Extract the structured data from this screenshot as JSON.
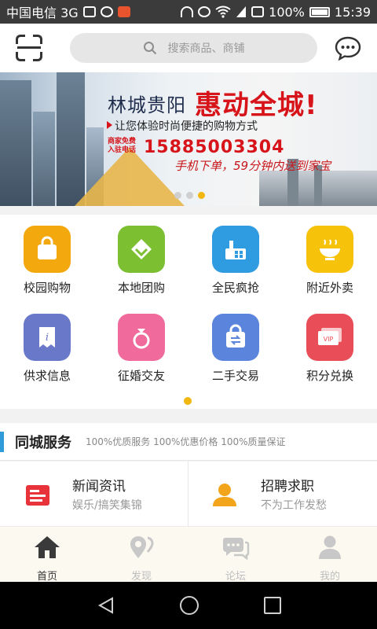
{
  "status_bar": {
    "carrier": "中国电信 3G",
    "battery": "100%",
    "time": "15:39"
  },
  "header": {
    "search_placeholder": "搜索商品、商铺",
    "icons": [
      "scan-icon",
      "search-icon",
      "chat-bubble-icon"
    ]
  },
  "banner": {
    "city": "林城贵阳",
    "headline": "惠动全城!",
    "tagline": "让您体验时尚便捷的购物方式",
    "hotline_label_1": "商家免费",
    "hotline_label_2": "入驻电话",
    "phone": "15885003304",
    "slogan": "手机下单，59分钟内送到家宝",
    "pager": {
      "count": 3,
      "active": 3
    }
  },
  "grid": {
    "items": [
      {
        "label": "校园购物",
        "icon": "shopping-bag-icon",
        "color": "#f3a80e"
      },
      {
        "label": "本地团购",
        "icon": "group-buy-icon",
        "color": "#7cbf30"
      },
      {
        "label": "全民疯抢",
        "icon": "flash-sale-icon",
        "color": "#2f9be0"
      },
      {
        "label": "附近外卖",
        "icon": "food-bowl-icon",
        "color": "#f6c20a"
      },
      {
        "label": "供求信息",
        "icon": "info-doc-icon",
        "color": "#6a78c9"
      },
      {
        "label": "征婚交友",
        "icon": "ring-icon",
        "color": "#f06b9c"
      },
      {
        "label": "二手交易",
        "icon": "exchange-bag-icon",
        "color": "#5b84dc"
      },
      {
        "label": "积分兑换",
        "icon": "vip-card-icon",
        "color": "#e94d57"
      }
    ],
    "pager_active": 1
  },
  "section": {
    "title": "同城服务",
    "tags": "100%优质服务  100%优惠价格  100%质量保证"
  },
  "cards": [
    {
      "title": "新闻资讯",
      "subtitle": "娱乐/搞笑集锦",
      "icon": "news-icon",
      "color": "#e8333a"
    },
    {
      "title": "招聘求职",
      "subtitle": "不为工作发愁",
      "icon": "person-icon",
      "color": "#f2a51b"
    }
  ],
  "bottom_nav": [
    {
      "label": "首页",
      "icon": "home-icon",
      "active": true
    },
    {
      "label": "发现",
      "icon": "location-icon",
      "active": false
    },
    {
      "label": "论坛",
      "icon": "forum-icon",
      "active": false
    },
    {
      "label": "我的",
      "icon": "user-icon",
      "active": false
    }
  ],
  "colors": {
    "accent": "#f1b70f",
    "section_bar": "#2f9bd8",
    "banner_red": "#d6141a"
  }
}
